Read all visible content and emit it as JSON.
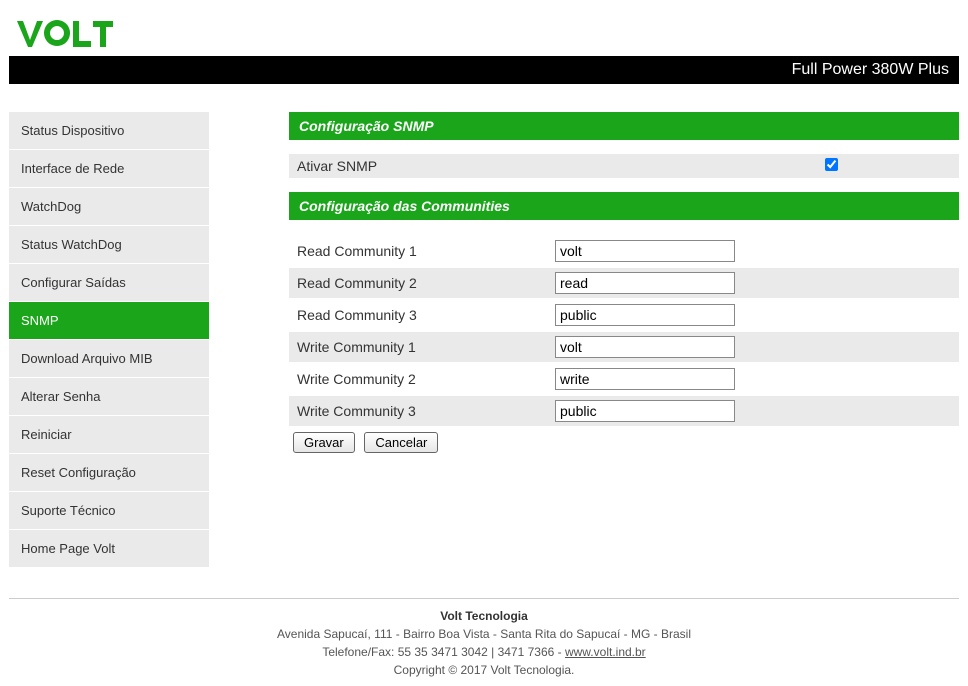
{
  "logo_text": "VOLT",
  "header": {
    "title": "Full Power 380W Plus"
  },
  "sidebar": {
    "items": [
      {
        "label": "Status Dispositivo",
        "active": false
      },
      {
        "label": "Interface de Rede",
        "active": false
      },
      {
        "label": "WatchDog",
        "active": false
      },
      {
        "label": "Status WatchDog",
        "active": false
      },
      {
        "label": "Configurar Saídas",
        "active": false
      },
      {
        "label": "SNMP",
        "active": true
      },
      {
        "label": "Download Arquivo MIB",
        "active": false
      },
      {
        "label": "Alterar Senha",
        "active": false
      },
      {
        "label": "Reiniciar",
        "active": false
      },
      {
        "label": "Reset Configuração",
        "active": false
      },
      {
        "label": "Suporte Técnico",
        "active": false
      },
      {
        "label": "Home Page Volt",
        "active": false
      }
    ]
  },
  "section1": {
    "title": "Configuração SNMP"
  },
  "activate": {
    "label": "Ativar SNMP",
    "checked": true
  },
  "section2": {
    "title": "Configuração das Communities"
  },
  "communities": {
    "rows": [
      {
        "label": "Read Community 1",
        "value": "volt",
        "grey": false
      },
      {
        "label": "Read Community 2",
        "value": "read",
        "grey": true
      },
      {
        "label": "Read Community 3",
        "value": "public",
        "grey": false
      },
      {
        "label": "Write Community 1",
        "value": "volt",
        "grey": true
      },
      {
        "label": "Write Community 2",
        "value": "write",
        "grey": false
      },
      {
        "label": "Write Community 3",
        "value": "public",
        "grey": true
      }
    ]
  },
  "buttons": {
    "save": "Gravar",
    "cancel": "Cancelar"
  },
  "footer": {
    "company": "Volt Tecnologia",
    "address": "Avenida Sapucaí, 111 - Bairro Boa Vista - Santa Rita do Sapucaí - MG - Brasil",
    "phone_prefix": "Telefone/Fax: 55 35 3471 3042 | 3471 7366 - ",
    "site": "www.volt.ind.br",
    "copyright": "Copyright © 2017 Volt Tecnologia."
  }
}
